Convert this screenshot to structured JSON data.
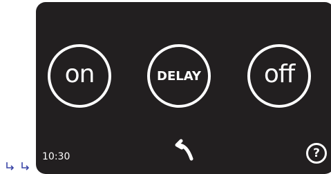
{
  "screen": {
    "panel_color": "#221f20",
    "foreground_color": "#ffffff"
  },
  "buttons": {
    "on_label": "on",
    "delay_label": "DELAY",
    "off_label": "off"
  },
  "status": {
    "time": "10:30"
  },
  "icons": {
    "back": "undo-arrow-icon",
    "help": "question-mark-icon",
    "help_glyph": "?",
    "corner": "return-arrow-icons"
  },
  "corner_arrows_color": "#3a45a6"
}
